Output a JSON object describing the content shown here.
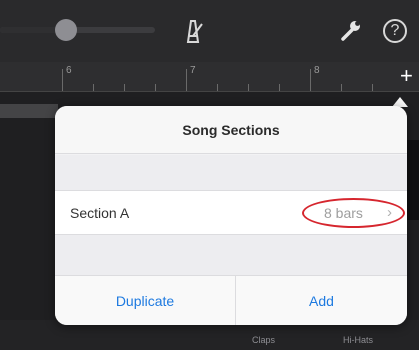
{
  "ruler": {
    "bars": [
      "6",
      "7",
      "8"
    ]
  },
  "popover": {
    "title": "Song Sections",
    "section": {
      "name": "Section A",
      "length": "8 bars",
      "chevron": "›"
    },
    "actions": {
      "duplicate": "Duplicate",
      "add": "Add"
    }
  },
  "pads": {
    "left": "Claps",
    "right": "Hi-Hats"
  },
  "toolbar": {
    "help_glyph": "?",
    "add_glyph": "+"
  },
  "colors": {
    "accent": "#1e7ae0",
    "annotation": "#d6262e",
    "background": "#1c1c1e"
  }
}
